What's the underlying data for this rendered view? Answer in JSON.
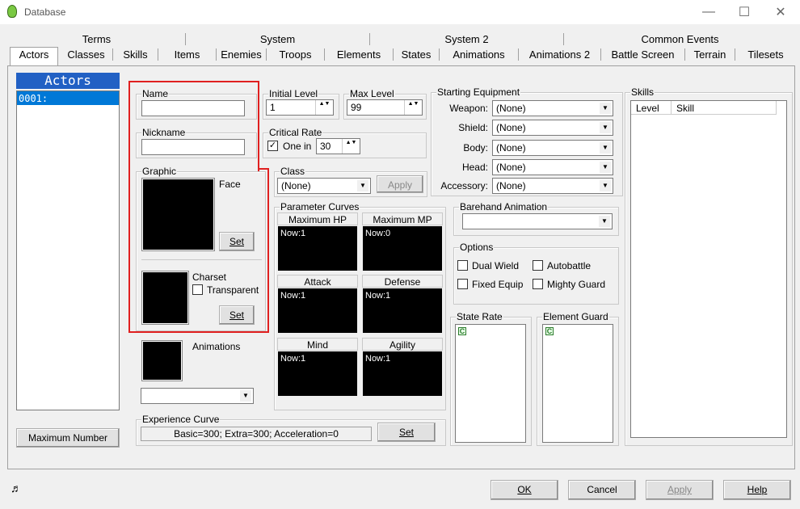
{
  "window": {
    "title": "Database",
    "minimize": "—",
    "maximize": "☐",
    "close": "✕"
  },
  "tabs_row1": [
    "Terms",
    "System",
    "System 2",
    "Common Events"
  ],
  "tabs_row2": [
    "Actors",
    "Classes",
    "Skills",
    "Items",
    "Enemies",
    "Troops",
    "Elements",
    "States",
    "Animations",
    "Animations 2",
    "Battle Screen",
    "Terrain",
    "Tilesets"
  ],
  "actors": {
    "header": "Actors",
    "items": [
      "0001:"
    ],
    "max_button": "Maximum Number"
  },
  "name": {
    "label": "Name",
    "value": ""
  },
  "nickname": {
    "label": "Nickname",
    "value": ""
  },
  "initial_level": {
    "label": "Initial Level",
    "value": "1"
  },
  "max_level": {
    "label": "Max Level",
    "value": "99"
  },
  "critical": {
    "label": "Critical Rate",
    "check_label": "One in",
    "value": "30",
    "checked": "✓"
  },
  "class": {
    "label": "Class",
    "value": "(None)",
    "apply": "Apply"
  },
  "graphic": {
    "label": "Graphic",
    "face": "Face",
    "set1": "Set",
    "charset": "Charset",
    "transparent": "Transparent",
    "set2": "Set"
  },
  "animations": {
    "label": "Animations"
  },
  "equipment": {
    "label": "Starting Equipment",
    "rows": [
      {
        "k": "Weapon:",
        "v": "(None)"
      },
      {
        "k": "Shield:",
        "v": "(None)"
      },
      {
        "k": "Body:",
        "v": "(None)"
      },
      {
        "k": "Head:",
        "v": "(None)"
      },
      {
        "k": "Accessory:",
        "v": "(None)"
      }
    ]
  },
  "skills": {
    "label": "Skills",
    "col_level": "Level",
    "col_skill": "Skill"
  },
  "param": {
    "label": "Parameter Curves",
    "items": [
      {
        "name": "Maximum HP",
        "now": "Now:1"
      },
      {
        "name": "Maximum MP",
        "now": "Now:0"
      },
      {
        "name": "Attack",
        "now": "Now:1"
      },
      {
        "name": "Defense",
        "now": "Now:1"
      },
      {
        "name": "Mind",
        "now": "Now:1"
      },
      {
        "name": "Agility",
        "now": "Now:1"
      }
    ]
  },
  "barehand": {
    "label": "Barehand Animation",
    "value": ""
  },
  "options": {
    "label": "Options",
    "dual": "Dual Wield",
    "auto": "Autobattle",
    "fixed": "Fixed Equip",
    "mighty": "Mighty Guard"
  },
  "state_rate": {
    "label": "State Rate",
    "icon": "C"
  },
  "element_guard": {
    "label": "Element Guard",
    "icon": "C"
  },
  "exp": {
    "label": "Experience Curve",
    "value": "Basic=300; Extra=300; Acceleration=0",
    "set": "Set"
  },
  "footer": {
    "ok": "OK",
    "cancel": "Cancel",
    "apply": "Apply",
    "help": "Help"
  },
  "colors": {
    "accent": "#0078d7",
    "selection": "#0078d7",
    "highlight_box": "#e02020"
  }
}
